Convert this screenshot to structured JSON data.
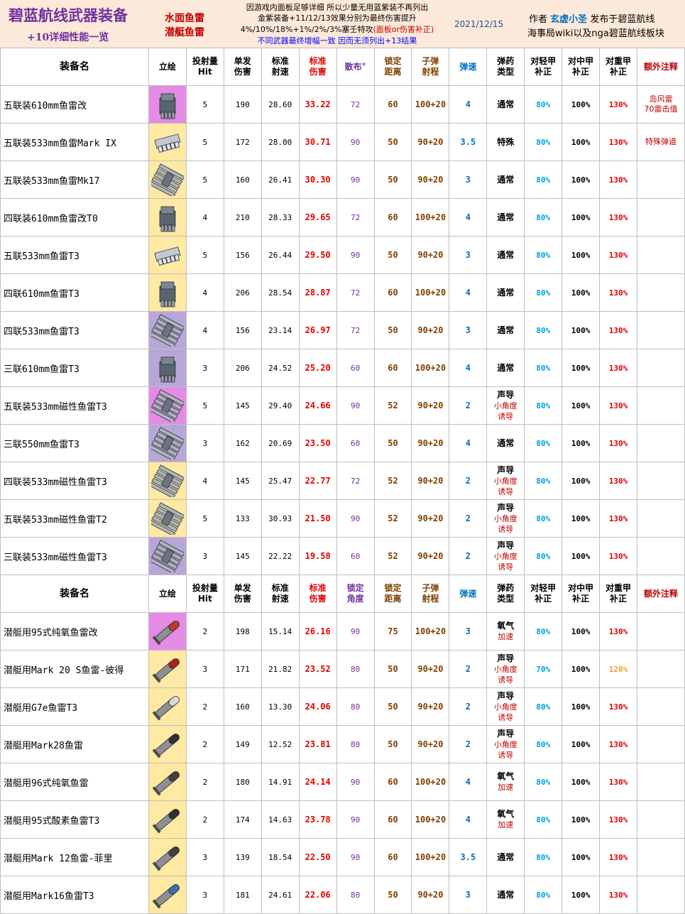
{
  "header": {
    "title": "碧蓝航线武器装备",
    "subtitle": "+10详细性能一览",
    "categories": [
      "水面鱼雷",
      "潜艇鱼雷"
    ],
    "note_line1": "因游戏内面板足够详细 所以少量无用蓝紫装不再列出",
    "note_line2": "金紫装备+11/12/13效果分别为最终伤害提升",
    "note_line3_a": "4%/10%/18%+1%/2%/3%塞壬特攻",
    "note_line3_b": "(面板or伤害补正)",
    "note_line4": "不同武器最终增幅一致 因而无须列出+13结果",
    "date": "2021/12/15",
    "author_prefix": "作者",
    "author_name": "玄虚小圣",
    "author_suffix": "发布于碧蓝航线",
    "published": "海事局wiki以及nga碧蓝航线板块"
  },
  "columns_surface": {
    "name": "装备名",
    "art": "立绘",
    "hit_1": "投射量",
    "hit_2": "Hit",
    "dmg_1": "单发",
    "dmg_2": "伤害",
    "rate_1": "标准",
    "rate_2": "射速",
    "std_1": "标准",
    "std_2": "伤害",
    "spread": "散布°",
    "lock_1": "锁定",
    "lock_2": "距离",
    "range_1": "子弹",
    "range_2": "射程",
    "vel": "弹速",
    "type_1": "弹药",
    "type_2": "类型",
    "light_1": "对轻甲",
    "light_2": "补正",
    "mid_1": "对中甲",
    "mid_2": "补正",
    "heavy_1": "对重甲",
    "heavy_2": "补正",
    "note": "额外注释"
  },
  "columns_sub": {
    "name": "装备名",
    "art": "立绘",
    "hit_1": "投射量",
    "hit_2": "Hit",
    "dmg_1": "单发",
    "dmg_2": "伤害",
    "rate_1": "标准",
    "rate_2": "射速",
    "std_1": "标准",
    "std_2": "伤害",
    "spread_1": "锁定",
    "spread_2": "角度",
    "lock_1": "锁定",
    "lock_2": "距离",
    "range_1": "子弹",
    "range_2": "射程",
    "vel": "弹速",
    "type_1": "弹药",
    "type_2": "类型",
    "light_1": "对轻甲",
    "light_2": "补正",
    "mid_1": "对中甲",
    "mid_2": "补正",
    "heavy_1": "对重甲",
    "heavy_2": "补正",
    "note": "额外注释"
  },
  "surface": [
    {
      "name": "五联装610mm鱼雷改",
      "bg": "#e48be6",
      "icon": "launcher-block-icon",
      "hit": "5",
      "dmg": "190",
      "rate": "28.60",
      "std": "33.22",
      "spread": "72",
      "lock": "60",
      "range": "100+20",
      "vel": "4",
      "type": "通常",
      "type_sub": "",
      "light": "80%",
      "mid": "100%",
      "heavy": "130%",
      "note": "岛风雷\n70雷击值"
    },
    {
      "name": "五联装533mm鱼雷Mark IX",
      "bg": "#ffe9a3",
      "icon": "launcher-flat-icon",
      "hit": "5",
      "dmg": "172",
      "rate": "28.00",
      "std": "30.71",
      "spread": "90",
      "lock": "50",
      "range": "90+20",
      "vel": "3.5",
      "type": "特殊",
      "type_sub": "",
      "light": "80%",
      "mid": "100%",
      "heavy": "130%",
      "note": "特殊弹道"
    },
    {
      "name": "五联装533mm鱼雷Mk17",
      "bg": "#ffe9a3",
      "icon": "launcher-tubes-icon",
      "hit": "5",
      "dmg": "160",
      "rate": "26.41",
      "std": "30.30",
      "spread": "90",
      "lock": "50",
      "range": "90+20",
      "vel": "3",
      "type": "通常",
      "type_sub": "",
      "light": "80%",
      "mid": "100%",
      "heavy": "130%",
      "note": ""
    },
    {
      "name": "四联装610mm鱼雷改T0",
      "bg": "#ffe9a3",
      "icon": "launcher-block-icon",
      "hit": "4",
      "dmg": "210",
      "rate": "28.33",
      "std": "29.65",
      "spread": "72",
      "lock": "60",
      "range": "100+20",
      "vel": "4",
      "type": "通常",
      "type_sub": "",
      "light": "80%",
      "mid": "100%",
      "heavy": "130%",
      "note": ""
    },
    {
      "name": "五联533mm鱼雷T3",
      "bg": "#ffe9a3",
      "icon": "launcher-flat-icon",
      "hit": "5",
      "dmg": "156",
      "rate": "26.44",
      "std": "29.50",
      "spread": "90",
      "lock": "50",
      "range": "90+20",
      "vel": "3",
      "type": "通常",
      "type_sub": "",
      "light": "80%",
      "mid": "100%",
      "heavy": "130%",
      "note": ""
    },
    {
      "name": "四联610mm鱼雷T3",
      "bg": "#ffe9a3",
      "icon": "launcher-block-icon",
      "hit": "4",
      "dmg": "206",
      "rate": "28.54",
      "std": "28.87",
      "spread": "72",
      "lock": "60",
      "range": "100+20",
      "vel": "4",
      "type": "通常",
      "type_sub": "",
      "light": "80%",
      "mid": "100%",
      "heavy": "130%",
      "note": ""
    },
    {
      "name": "四联533mm鱼雷T3",
      "bg": "#b9a6d8",
      "icon": "launcher-tubes-icon",
      "hit": "4",
      "dmg": "156",
      "rate": "23.14",
      "std": "26.97",
      "spread": "72",
      "lock": "50",
      "range": "90+20",
      "vel": "3",
      "type": "通常",
      "type_sub": "",
      "light": "80%",
      "mid": "100%",
      "heavy": "130%",
      "note": ""
    },
    {
      "name": "三联610mm鱼雷T3",
      "bg": "#b9a6d8",
      "icon": "launcher-block-icon",
      "hit": "3",
      "dmg": "206",
      "rate": "24.52",
      "std": "25.20",
      "spread": "60",
      "lock": "60",
      "range": "100+20",
      "vel": "4",
      "type": "通常",
      "type_sub": "",
      "light": "80%",
      "mid": "100%",
      "heavy": "130%",
      "note": ""
    },
    {
      "name": "五联装533mm磁性鱼雷T3",
      "bg": "#e48be6",
      "icon": "launcher-tubes-icon",
      "hit": "5",
      "dmg": "145",
      "rate": "29.40",
      "std": "24.66",
      "spread": "90",
      "lock": "52",
      "range": "90+20",
      "vel": "2",
      "type": "声导",
      "type_sub": "小角度\n诱导",
      "light": "80%",
      "mid": "100%",
      "heavy": "130%",
      "note": ""
    },
    {
      "name": "三联550mm鱼雷T3",
      "bg": "#b9a6d8",
      "icon": "launcher-tubes-icon",
      "hit": "3",
      "dmg": "162",
      "rate": "20.69",
      "std": "23.50",
      "spread": "60",
      "lock": "50",
      "range": "90+20",
      "vel": "4",
      "type": "通常",
      "type_sub": "",
      "light": "80%",
      "mid": "100%",
      "heavy": "130%",
      "note": ""
    },
    {
      "name": "四联装533mm磁性鱼雷T3",
      "bg": "#ffe9a3",
      "icon": "launcher-tubes-icon",
      "hit": "4",
      "dmg": "145",
      "rate": "25.47",
      "std": "22.77",
      "spread": "72",
      "lock": "52",
      "range": "90+20",
      "vel": "2",
      "type": "声导",
      "type_sub": "小角度\n诱导",
      "light": "80%",
      "mid": "100%",
      "heavy": "130%",
      "note": ""
    },
    {
      "name": "五联装533mm磁性鱼雷T2",
      "bg": "#ffe9a3",
      "icon": "launcher-tubes-icon",
      "hit": "5",
      "dmg": "133",
      "rate": "30.93",
      "std": "21.50",
      "spread": "90",
      "lock": "52",
      "range": "90+20",
      "vel": "2",
      "type": "声导",
      "type_sub": "小角度\n诱导",
      "light": "80%",
      "mid": "100%",
      "heavy": "130%",
      "note": ""
    },
    {
      "name": "三联装533mm磁性鱼雷T3",
      "bg": "#b9a6d8",
      "icon": "launcher-tubes-icon",
      "hit": "3",
      "dmg": "145",
      "rate": "22.22",
      "std": "19.58",
      "spread": "60",
      "lock": "52",
      "range": "90+20",
      "vel": "2",
      "type": "声导",
      "type_sub": "小角度\n诱导",
      "light": "80%",
      "mid": "100%",
      "heavy": "130%",
      "note": ""
    }
  ],
  "submarine": [
    {
      "name": "潜艇用95式纯氧鱼雷改",
      "bg": "#e48be6",
      "tip": "#c0392b",
      "hit": "2",
      "dmg": "198",
      "rate": "15.14",
      "std": "26.16",
      "spread": "90",
      "lock": "75",
      "range": "100+20",
      "vel": "3",
      "type": "氧气",
      "type_sub": "加速",
      "light": "80%",
      "mid": "100%",
      "heavy": "130%",
      "heavy_color": "",
      "note": ""
    },
    {
      "name": "潜艇用Mark 20 S鱼雷-彼得",
      "bg": "#ffe9a3",
      "tip": "#b02020",
      "hit": "3",
      "dmg": "171",
      "rate": "21.82",
      "std": "23.52",
      "spread": "80",
      "lock": "50",
      "range": "90+20",
      "vel": "2",
      "type": "声导",
      "type_sub": "小角度\n诱导",
      "light": "70%",
      "mid": "100%",
      "heavy": "120%",
      "heavy_color": "#f29d2a",
      "note": ""
    },
    {
      "name": "潜艇用G7e鱼雷T3",
      "bg": "#ffe9a3",
      "tip": "#d9d9d9",
      "hit": "2",
      "dmg": "160",
      "rate": "13.30",
      "std": "24.06",
      "spread": "80",
      "lock": "50",
      "range": "90+20",
      "vel": "2",
      "type": "声导",
      "type_sub": "小角度\n诱导",
      "light": "80%",
      "mid": "100%",
      "heavy": "130%",
      "heavy_color": "",
      "note": ""
    },
    {
      "name": "潜艇用Mark28鱼雷",
      "bg": "#ffe9a3",
      "tip": "#303030",
      "hit": "2",
      "dmg": "149",
      "rate": "12.52",
      "std": "23.81",
      "spread": "80",
      "lock": "50",
      "range": "90+20",
      "vel": "2",
      "type": "声导",
      "type_sub": "小角度\n诱导",
      "light": "80%",
      "mid": "100%",
      "heavy": "130%",
      "heavy_color": "",
      "note": ""
    },
    {
      "name": "潜艇用96式纯氧鱼雷",
      "bg": "#ffe9a3",
      "tip": "#404040",
      "hit": "2",
      "dmg": "180",
      "rate": "14.91",
      "std": "24.14",
      "spread": "90",
      "lock": "60",
      "range": "100+20",
      "vel": "4",
      "type": "氧气",
      "type_sub": "加速",
      "light": "80%",
      "mid": "100%",
      "heavy": "130%",
      "heavy_color": "",
      "note": ""
    },
    {
      "name": "潜艇用95式酸素鱼雷T3",
      "bg": "#ffe9a3",
      "tip": "#303030",
      "hit": "2",
      "dmg": "174",
      "rate": "14.63",
      "std": "23.78",
      "spread": "90",
      "lock": "60",
      "range": "100+20",
      "vel": "4",
      "type": "氧气",
      "type_sub": "加速",
      "light": "80%",
      "mid": "100%",
      "heavy": "130%",
      "heavy_color": "",
      "note": ""
    },
    {
      "name": "潜艇用Mark 12鱼雷-菲里",
      "bg": "#ffe9a3",
      "tip": "#404040",
      "hit": "3",
      "dmg": "139",
      "rate": "18.54",
      "std": "22.50",
      "spread": "90",
      "lock": "60",
      "range": "100+20",
      "vel": "3.5",
      "type": "通常",
      "type_sub": "",
      "light": "80%",
      "mid": "100%",
      "heavy": "130%",
      "heavy_color": "",
      "note": ""
    },
    {
      "name": "潜艇用Mark16鱼雷T3",
      "bg": "#ffe9a3",
      "tip": "#3d6fa8",
      "hit": "3",
      "dmg": "181",
      "rate": "24.61",
      "std": "22.06",
      "spread": "80",
      "lock": "50",
      "range": "90+20",
      "vel": "3",
      "type": "通常",
      "type_sub": "",
      "light": "80%",
      "mid": "100%",
      "heavy": "130%",
      "heavy_color": "",
      "note": ""
    }
  ]
}
